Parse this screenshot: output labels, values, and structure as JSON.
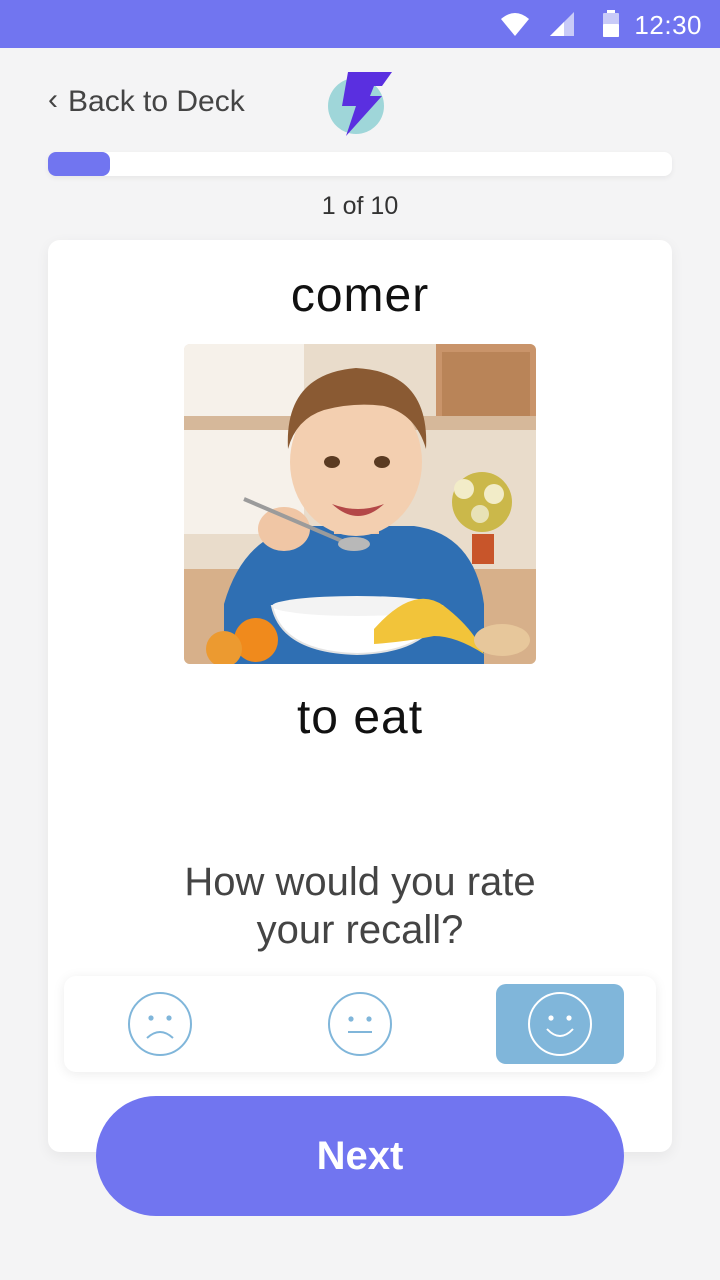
{
  "status_bar": {
    "time": "12:30",
    "icons": [
      "wifi-icon",
      "signal-icon",
      "battery-icon"
    ]
  },
  "header": {
    "back_chevron": "‹",
    "back_label": "Back to Deck",
    "logo_icon": "lightning-bolt-logo"
  },
  "progress": {
    "fraction": 0.1,
    "label": "1 of 10"
  },
  "card": {
    "term": "comer",
    "image_icon": "boy-eating-photo",
    "translation": "to eat",
    "question": "How would you rate your recall?"
  },
  "rating": {
    "options": [
      "sad-face-icon",
      "neutral-face-icon",
      "happy-face-icon"
    ],
    "selected": "happy"
  },
  "next_button": {
    "label": "Next"
  },
  "colors": {
    "accent": "#7175f0",
    "selected_rating": "#80b6da",
    "face_stroke": "#80b6da",
    "background": "#f4f4f5"
  }
}
